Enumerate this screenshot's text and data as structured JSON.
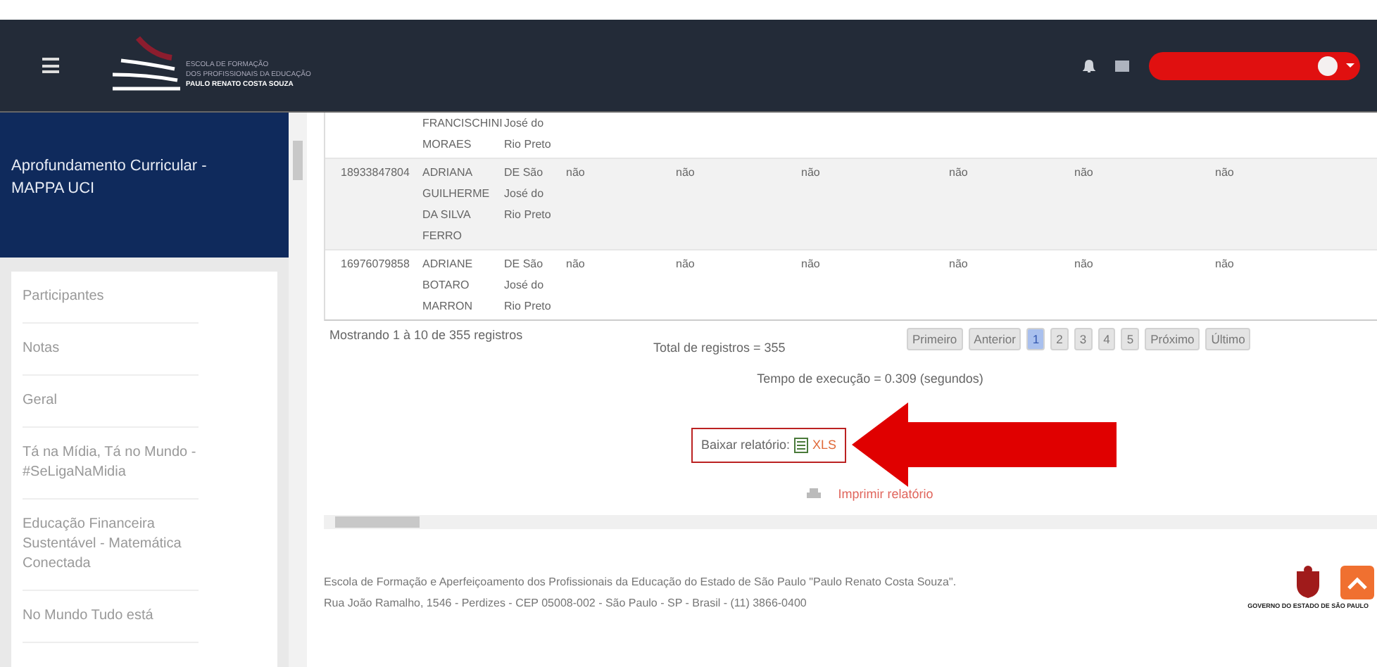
{
  "header": {
    "logo_lines": [
      "ESCOLA DE FORMAÇÃO",
      "DOS PROFISSIONAIS DA EDUCAÇÃO",
      "PAULO RENATO COSTA SOUZA"
    ]
  },
  "sidebar": {
    "title": "Aprofundamento Curricular - MAPPA UCI",
    "items": [
      {
        "label": "Participantes"
      },
      {
        "label": "Notas"
      },
      {
        "label": "Geral"
      },
      {
        "label": "Tá na Mídia, Tá no Mundo - #SeLigaNaMidia"
      },
      {
        "label": "Educação Financeira Sustentável - Matemática Conectada"
      },
      {
        "label": "No Mundo Tudo está"
      }
    ]
  },
  "table": {
    "rows": [
      {
        "cells": [
          "",
          "FRANCISCHINI MORAES",
          "José do Rio Preto",
          "",
          "",
          "",
          "",
          "",
          ""
        ]
      },
      {
        "cells": [
          "18933847804",
          "ADRIANA GUILHERME DA SILVA FERRO",
          "DE São José do Rio Preto",
          "não",
          "não",
          "não",
          "não",
          "não",
          "não"
        ]
      },
      {
        "cells": [
          "16976079858",
          "ADRIANE BOTARO MARRON",
          "DE São José do Rio Preto",
          "não",
          "não",
          "não",
          "não",
          "não",
          "não"
        ]
      }
    ]
  },
  "summary": "Mostrando 1 à 10 de 355 registros",
  "total": "Total de registros = 355",
  "pagination": [
    {
      "label": "Primeiro",
      "selected": false
    },
    {
      "label": "Anterior",
      "selected": false
    },
    {
      "label": "1",
      "selected": true
    },
    {
      "label": "2",
      "selected": false
    },
    {
      "label": "3",
      "selected": false
    },
    {
      "label": "4",
      "selected": false
    },
    {
      "label": "5",
      "selected": false
    },
    {
      "label": "Próximo",
      "selected": false
    },
    {
      "label": "Último",
      "selected": false
    }
  ],
  "execution_time": "Tempo de execução = 0.309 (segundos)",
  "download": {
    "label": "Baixar relatório:",
    "link": "XLS"
  },
  "print_link": "Imprimir relatório",
  "footer": {
    "lines": [
      "Escola de Formação e Aperfeiçoamento dos Profissionais da Educação do Estado de São Paulo \"Paulo Renato Costa Souza\".",
      "Rua João Ramalho, 1546 - Perdizes - CEP 05008-002 - São Paulo - SP - Brasil - (11) 3866-0400"
    ],
    "gov_label": "GOVERNO DO ESTADO DE SÃO PAULO"
  }
}
